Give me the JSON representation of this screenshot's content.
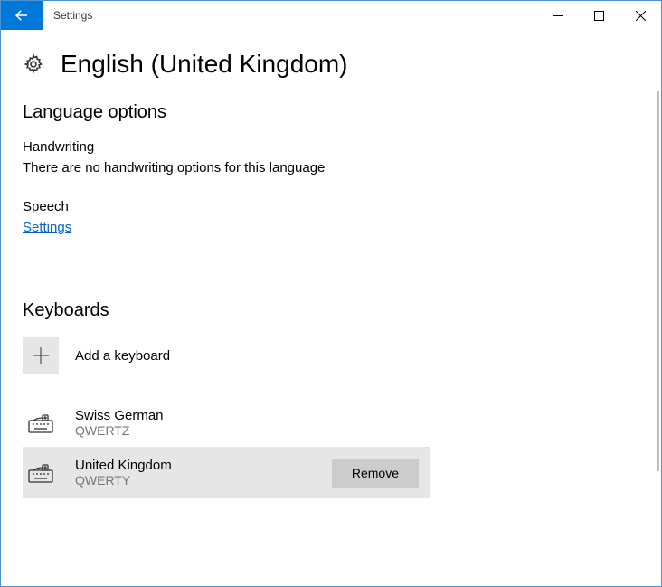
{
  "window": {
    "title": "Settings"
  },
  "header": {
    "title": "English (United Kingdom)"
  },
  "languageOptions": {
    "heading": "Language options",
    "handwritingLabel": "Handwriting",
    "handwritingInfo": "There are no handwriting options for this language",
    "speechLabel": "Speech",
    "speechLink": "Settings"
  },
  "keyboards": {
    "heading": "Keyboards",
    "addLabel": "Add a keyboard",
    "items": [
      {
        "name": "Swiss German",
        "layout": "QWERTZ"
      },
      {
        "name": "United Kingdom",
        "layout": "QWERTY"
      }
    ],
    "removeLabel": "Remove"
  }
}
